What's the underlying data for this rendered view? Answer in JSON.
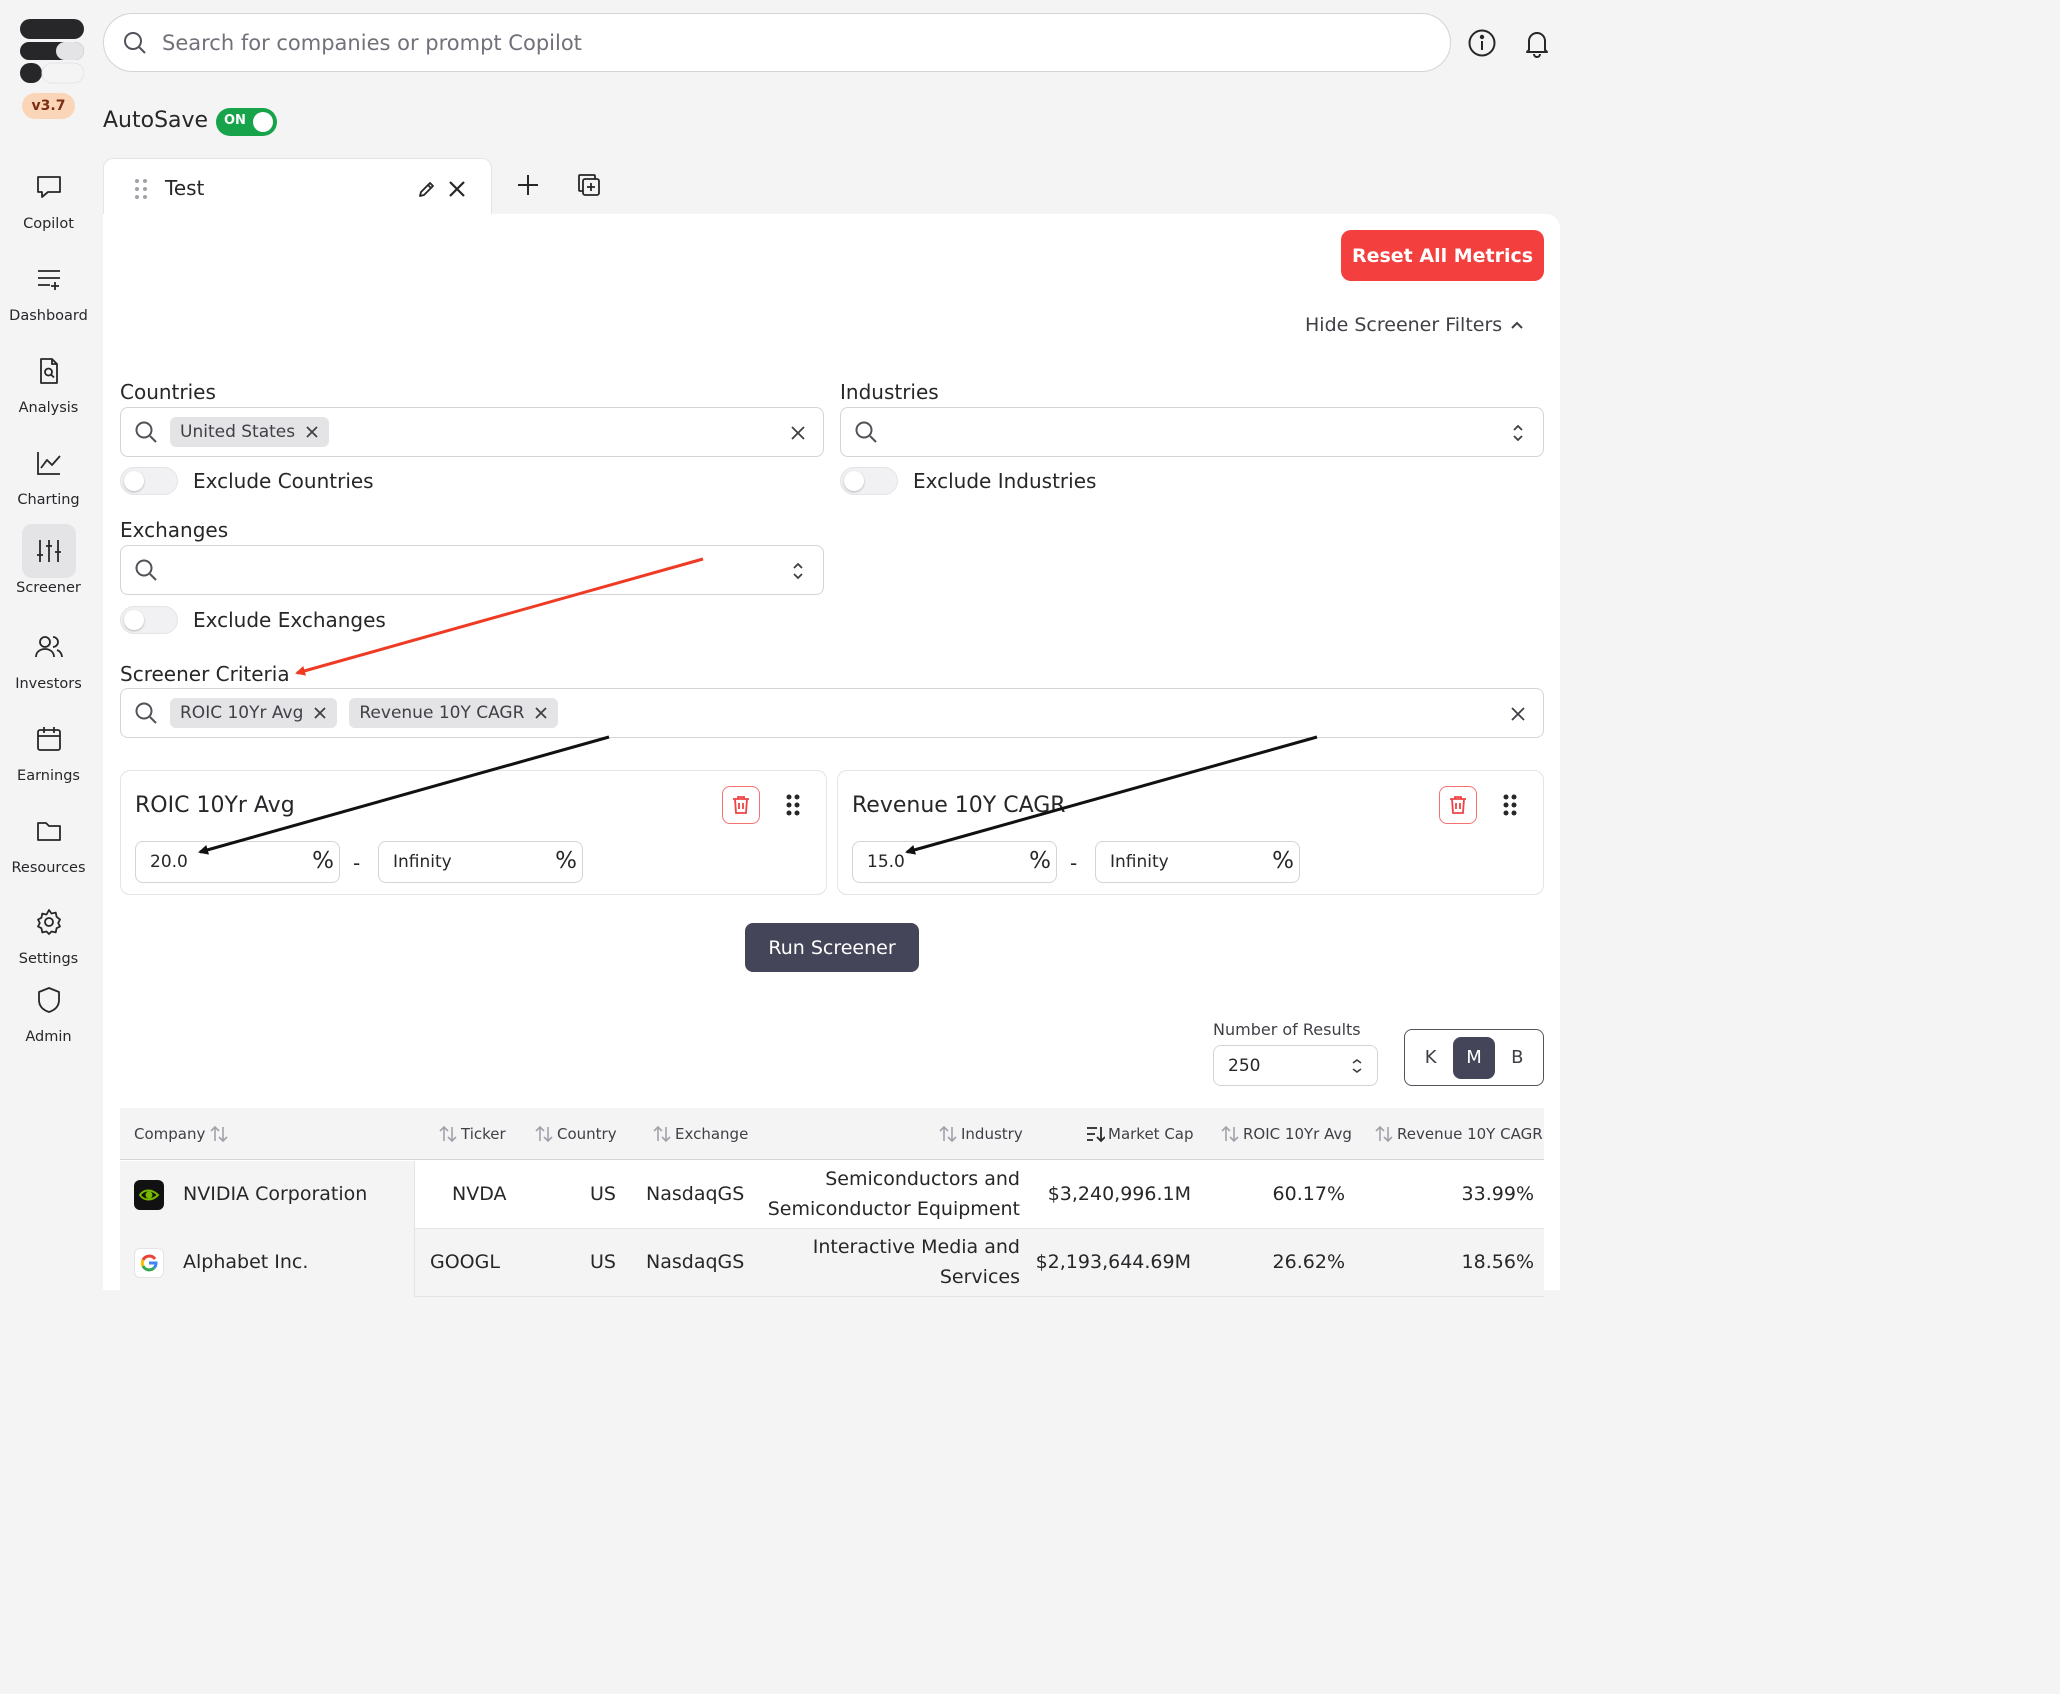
{
  "app": {
    "version": "v3.7"
  },
  "sidebar": {
    "items": [
      {
        "label": "Copilot",
        "icon": "chat-icon"
      },
      {
        "label": "Dashboard",
        "icon": "list-plus-icon"
      },
      {
        "label": "Analysis",
        "icon": "document-search-icon"
      },
      {
        "label": "Charting",
        "icon": "line-chart-icon"
      },
      {
        "label": "Screener",
        "icon": "sliders-icon"
      },
      {
        "label": "Investors",
        "icon": "users-icon"
      },
      {
        "label": "Earnings",
        "icon": "calendar-icon"
      },
      {
        "label": "Resources",
        "icon": "folder-icon"
      },
      {
        "label": "Settings",
        "icon": "gear-icon"
      },
      {
        "label": "Admin",
        "icon": "shield-icon"
      }
    ],
    "active": "Screener"
  },
  "search": {
    "placeholder": "Search for companies or prompt Copilot"
  },
  "autosave": {
    "label": "AutoSave",
    "state": "ON"
  },
  "tabs": [
    {
      "label": "Test"
    }
  ],
  "toolbar": {
    "reset_label": "Reset All Metrics",
    "hide_filters_label": "Hide Screener Filters"
  },
  "filters": {
    "countries": {
      "label": "Countries",
      "chips": [
        "United States"
      ],
      "exclude_label": "Exclude Countries"
    },
    "industries": {
      "label": "Industries",
      "chips": [],
      "exclude_label": "Exclude Industries"
    },
    "exchanges": {
      "label": "Exchanges",
      "chips": [],
      "exclude_label": "Exclude Exchanges"
    },
    "criteria": {
      "label": "Screener Criteria",
      "chips": [
        "ROIC 10Yr Avg",
        "Revenue 10Y CAGR"
      ]
    }
  },
  "criteria_cards": [
    {
      "title": "ROIC 10Yr Avg",
      "min": "20.0",
      "max": "Infinity",
      "unit": "%",
      "separator": "-"
    },
    {
      "title": "Revenue 10Y CAGR",
      "min": "15.0",
      "max": "Infinity",
      "unit": "%",
      "separator": "-"
    }
  ],
  "run_label": "Run Screener",
  "results": {
    "label": "Number of Results",
    "value": "250",
    "units": [
      "K",
      "M",
      "B"
    ],
    "active_unit": "M"
  },
  "table": {
    "columns": [
      "Company",
      "Ticker",
      "Country",
      "Exchange",
      "Industry",
      "Market Cap",
      "ROIC 10Yr Avg",
      "Revenue 10Y CAGR"
    ],
    "rows": [
      {
        "company": "NVIDIA Corporation",
        "ticker": "NVDA",
        "country": "US",
        "exchange": "NasdaqGS",
        "industry_1": "Semiconductors and",
        "industry_2": "Semiconductor Equipment",
        "market_cap": "$3,240,996.1M",
        "roic": "60.17%",
        "revenue_cagr": "33.99%"
      },
      {
        "company": "Alphabet Inc.",
        "ticker": "GOOGL",
        "country": "US",
        "exchange": "NasdaqGS",
        "industry_1": "Interactive Media and",
        "industry_2": "Services",
        "market_cap": "$2,193,644.69M",
        "roic": "26.62%",
        "revenue_cagr": "18.56%"
      }
    ]
  },
  "colors": {
    "accent_red": "#f43f3f",
    "toggle_on": "#16a34a",
    "button_dark": "#45455a",
    "nvidia_green": "#76b900"
  }
}
